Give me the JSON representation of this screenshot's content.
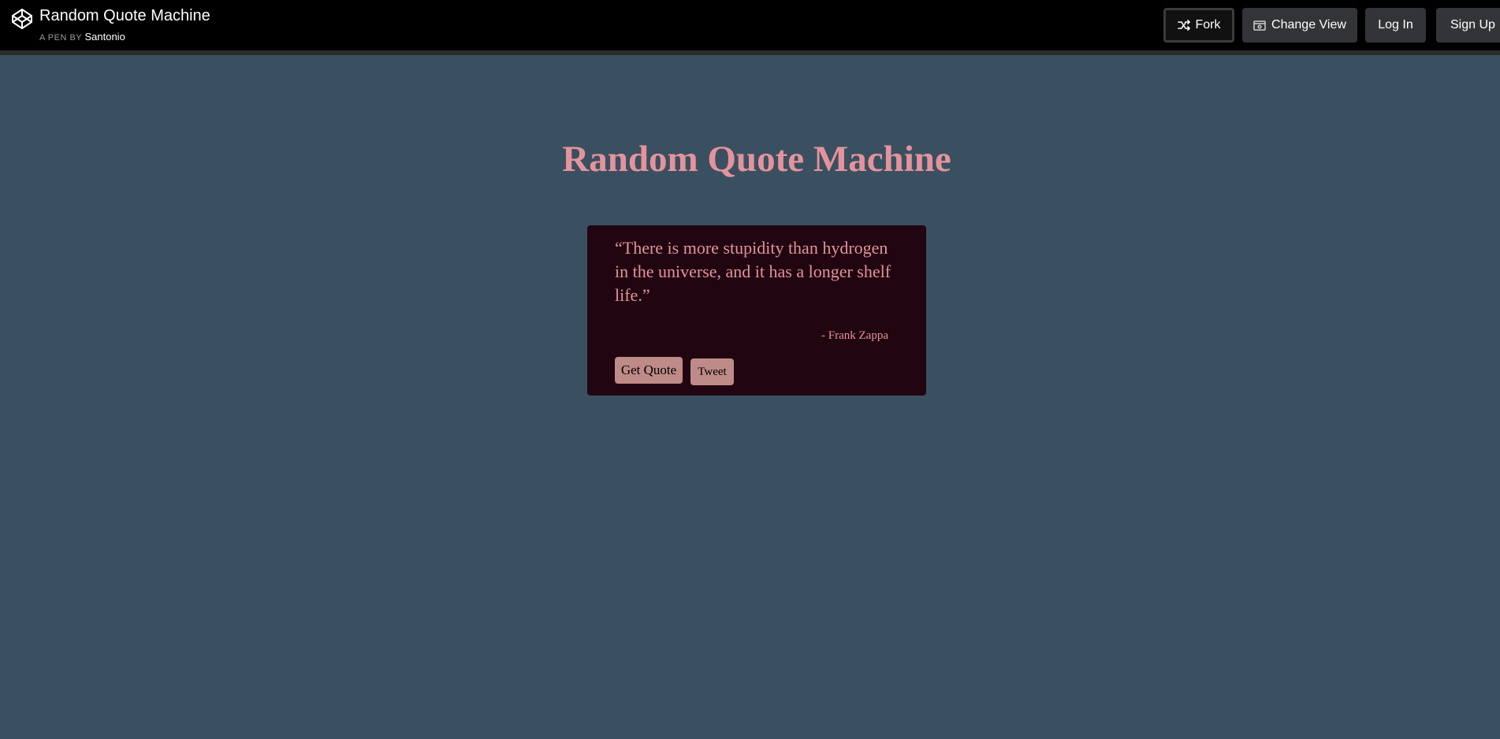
{
  "header": {
    "pen_title": "Random Quote Machine",
    "by_label": "A PEN BY",
    "author": "Santonio",
    "buttons": {
      "fork": "Fork",
      "change_view": "Change View",
      "log_in": "Log In",
      "sign_up": "Sign Up"
    },
    "logo_icon": "codepen-logo-icon"
  },
  "main": {
    "heading": "Random Quote Machine",
    "quote": {
      "text": " “There is more stupidity than hydrogen in the universe, and it has a longer shelf life.”",
      "author": "- Frank Zappa"
    },
    "buttons": {
      "get_quote": "Get Quote",
      "tweet": "Tweet"
    }
  },
  "colors": {
    "page_background": "#3a5060",
    "topbar_background": "#000000",
    "accent_pink": "#e4939d",
    "quote_box_background": "#210611",
    "quote_button_background": "#bf8b88"
  }
}
